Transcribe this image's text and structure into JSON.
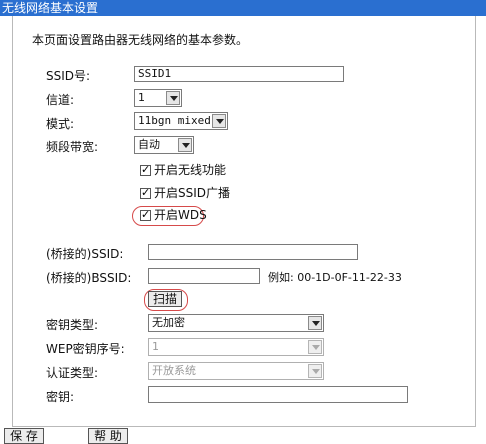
{
  "title": "无线网络基本设置",
  "intro": "本页面设置路由器无线网络的基本参数。",
  "fields": {
    "ssid_label": "SSID号:",
    "ssid_value": "SSID1",
    "channel_label": "信道:",
    "channel_value": "1",
    "mode_label": "模式:",
    "mode_value": "11bgn mixed",
    "bandwidth_label": "频段带宽:",
    "bandwidth_value": "自动"
  },
  "checkboxes": {
    "wireless": "开启无线功能",
    "ssid_broadcast": "开启SSID广播",
    "wds": "开启WDS"
  },
  "bridge": {
    "ssid_label": "(桥接的)SSID:",
    "bssid_label": "(桥接的)BSSID:",
    "example": "例如: 00-1D-0F-11-22-33",
    "scan_button": "扫描"
  },
  "security": {
    "key_type_label": "密钥类型:",
    "key_type_value": "无加密",
    "wep_index_label": "WEP密钥序号:",
    "wep_index_value": "1",
    "auth_type_label": "认证类型:",
    "auth_type_value": "开放系统",
    "key_label": "密钥:"
  },
  "buttons": {
    "save": "保 存",
    "help": "帮 助"
  }
}
